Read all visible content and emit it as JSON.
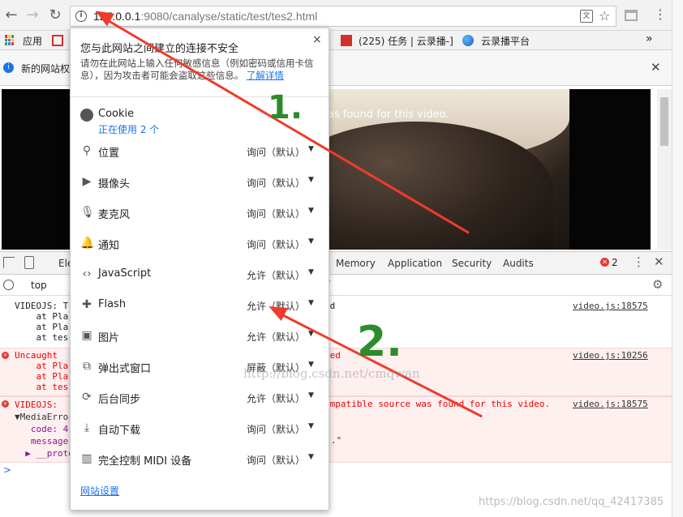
{
  "browser": {
    "url_host": "127.0.0.1",
    "url_rest": ":9080/canalyse/static/test/tes2.html",
    "bookmarks": [
      "应用",
      "(225) 任务 | 云录播-]",
      "云录播平台"
    ],
    "bookmarks_more": "»",
    "infobar_text": "新的网站权",
    "infobar_close": "✕"
  },
  "video": {
    "message": "as found for this video."
  },
  "popup": {
    "title": "您与此网站之间建立的连接不安全",
    "description": "请勿在此网站上输入任何敏感信息（例如密码或信用卡信息），因为攻击者可能会盗取这些信息。",
    "learn_more": "了解详情",
    "close": "×",
    "cookie_label": "Cookie",
    "cookie_sub": "正在使用 2 个",
    "permissions": [
      {
        "icon": "location-icon",
        "name": "位置",
        "value": "询问（默认）"
      },
      {
        "icon": "camera-icon",
        "name": "摄像头",
        "value": "询问（默认）"
      },
      {
        "icon": "microphone-icon",
        "name": "麦克风",
        "value": "询问（默认）"
      },
      {
        "icon": "bell-icon",
        "name": "通知",
        "value": "询问（默认）"
      },
      {
        "icon": "code-icon",
        "name": "JavaScript",
        "value": "允许（默认）"
      },
      {
        "icon": "puzzle-icon",
        "name": "Flash",
        "value": "允许（默认）"
      },
      {
        "icon": "image-icon",
        "name": "图片",
        "value": "允许（默认）"
      },
      {
        "icon": "popup-icon",
        "name": "弹出式窗口",
        "value": "屏蔽（默认）"
      },
      {
        "icon": "sync-icon",
        "name": "后台同步",
        "value": "允许（默认）"
      },
      {
        "icon": "download-icon",
        "name": "自动下载",
        "value": "询问（默认）"
      },
      {
        "icon": "midi-icon",
        "name": "完全控制 MIDI 设备",
        "value": "询问（默认）"
      }
    ],
    "site_settings": "网站设置"
  },
  "devtools": {
    "tabs": [
      "Ele",
      "Memory",
      "Application",
      "Security",
      "Audits"
    ],
    "error_count": "2",
    "context": "top",
    "logs": [
      {
        "type": "log",
        "lines": [
          "VIDEOJS: T",
          "    at Pla",
          "    at Pla",
          "    at tes"
        ],
        "tail": "ed",
        "source": "video.js:18575"
      },
      {
        "type": "error",
        "lines": [
          "Uncaught",
          "    at Pla",
          "    at Pla",
          "    at tes"
        ],
        "tail": "ned",
        "source": "video.js:10256"
      },
      {
        "type": "error",
        "lines": [
          "VIDEOJS:",
          "▼MediaErro",
          "   code: 4",
          "   message",
          "  ▶ __proto"
        ],
        "tail": "ompatible source was found for this video.",
        "source": "video.js:18575"
      }
    ],
    "prompt": ">"
  },
  "annotations": {
    "marker1": "1.",
    "marker2": "2.",
    "watermark_center": "http://blog.csdn.net/cmqwan",
    "watermark_corner": "https://blog.csdn.net/qq_42417385"
  },
  "colors": {
    "arrow": "#ef3b2c",
    "link": "#1a73e8",
    "marker": "#2c8c2c"
  }
}
